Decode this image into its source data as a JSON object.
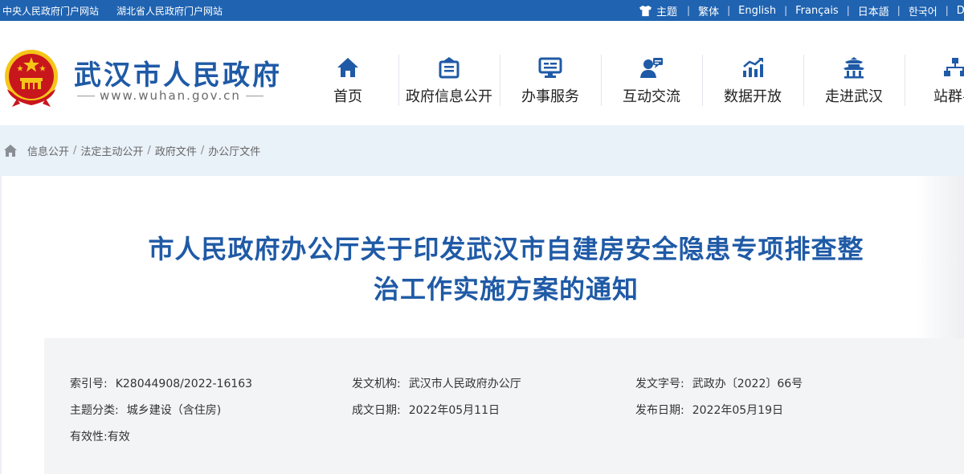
{
  "topbar": {
    "links": [
      "中央人民政府门户网站",
      "湖北省人民政府门户网站"
    ],
    "theme_label": "主题",
    "languages": [
      "繁体",
      "English",
      "Français",
      "日本語",
      "한국어",
      "D"
    ]
  },
  "header": {
    "site_name": "武汉市人民政府",
    "site_url": "www.wuhan.gov.cn",
    "nav": [
      {
        "label": "首页",
        "icon": "home-icon"
      },
      {
        "label": "政府信息公开",
        "icon": "info-disclosure-icon"
      },
      {
        "label": "办事服务",
        "icon": "service-icon"
      },
      {
        "label": "互动交流",
        "icon": "interaction-icon"
      },
      {
        "label": "数据开放",
        "icon": "data-chart-icon"
      },
      {
        "label": "走进武汉",
        "icon": "pavilion-icon"
      },
      {
        "label": "站群导",
        "icon": "sitemap-icon"
      }
    ]
  },
  "breadcrumb": [
    "信息公开",
    "法定主动公开",
    "政府文件",
    "办公厅文件"
  ],
  "document": {
    "title_line1": "市人民政府办公厅关于印发武汉市自建房安全隐患专项排查整",
    "title_line2": "治工作实施方案的通知",
    "meta": {
      "index_no": {
        "label": "索引号:",
        "value": "K28044908/2022-16163"
      },
      "issuer": {
        "label": "发文机构:",
        "value": "武汉市人民政府办公厅"
      },
      "doc_no": {
        "label": "发文字号:",
        "value": "武政办〔2022〕66号"
      },
      "category": {
        "label": "主题分类:",
        "value": "城乡建设（含住房)"
      },
      "written_date": {
        "label": "成文日期:",
        "value": "2022年05月11日"
      },
      "publish_date": {
        "label": "发布日期:",
        "value": "2022年05月19日"
      },
      "validity": {
        "label": "有效性:",
        "value": "有效"
      }
    }
  },
  "colors": {
    "topbar_bg": "#1f63b1",
    "brand_blue": "#1f5aa6",
    "breadcrumb_bg": "#e9f1f9",
    "meta_bg": "#f3f4f6",
    "emblem_red": "#c8161d",
    "emblem_gold": "#f5c518"
  }
}
